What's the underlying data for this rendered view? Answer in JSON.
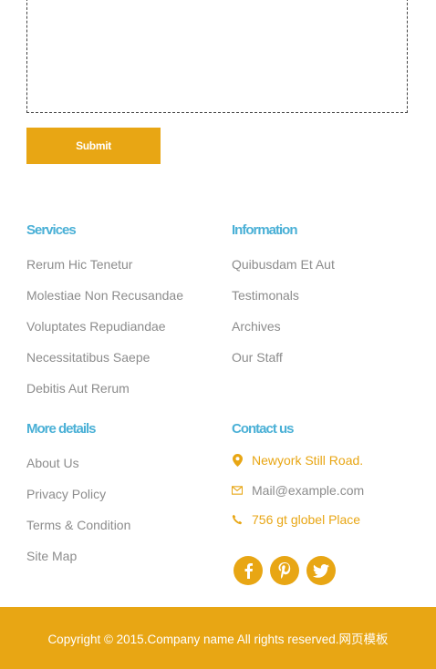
{
  "form": {
    "message_value": "",
    "submit_label": "Submit"
  },
  "services": {
    "heading": "Services",
    "items": [
      "Rerum Hic Tenetur",
      "Molestiae Non Recusandae",
      "Voluptates Repudiandae",
      "Necessitatibus Saepe",
      "Debitis Aut Rerum"
    ]
  },
  "information": {
    "heading": "Information",
    "items": [
      "Quibusdam Et Aut",
      "Testimonals",
      "Archives",
      "Our Staff"
    ]
  },
  "more_details": {
    "heading": "More details",
    "items": [
      "About Us",
      "Privacy Policy",
      "Terms & Condition",
      "Site Map"
    ]
  },
  "contact": {
    "heading": "Contact us",
    "address": "Newyork Still Road.",
    "email": "Mail@example.com",
    "phone": "756 gt globel Place"
  },
  "social": [
    "facebook-icon",
    "pinterest-icon",
    "twitter-icon"
  ],
  "footer": {
    "copyright": "Copyright © 2015.Company name All rights reserved.",
    "link_text": "网页模板"
  },
  "colors": {
    "accent": "#e8a614",
    "heading": "#4ab0d6",
    "link": "#8c8c8c",
    "contact_text": "#e8a614",
    "email_text": "#8c8c8c"
  }
}
